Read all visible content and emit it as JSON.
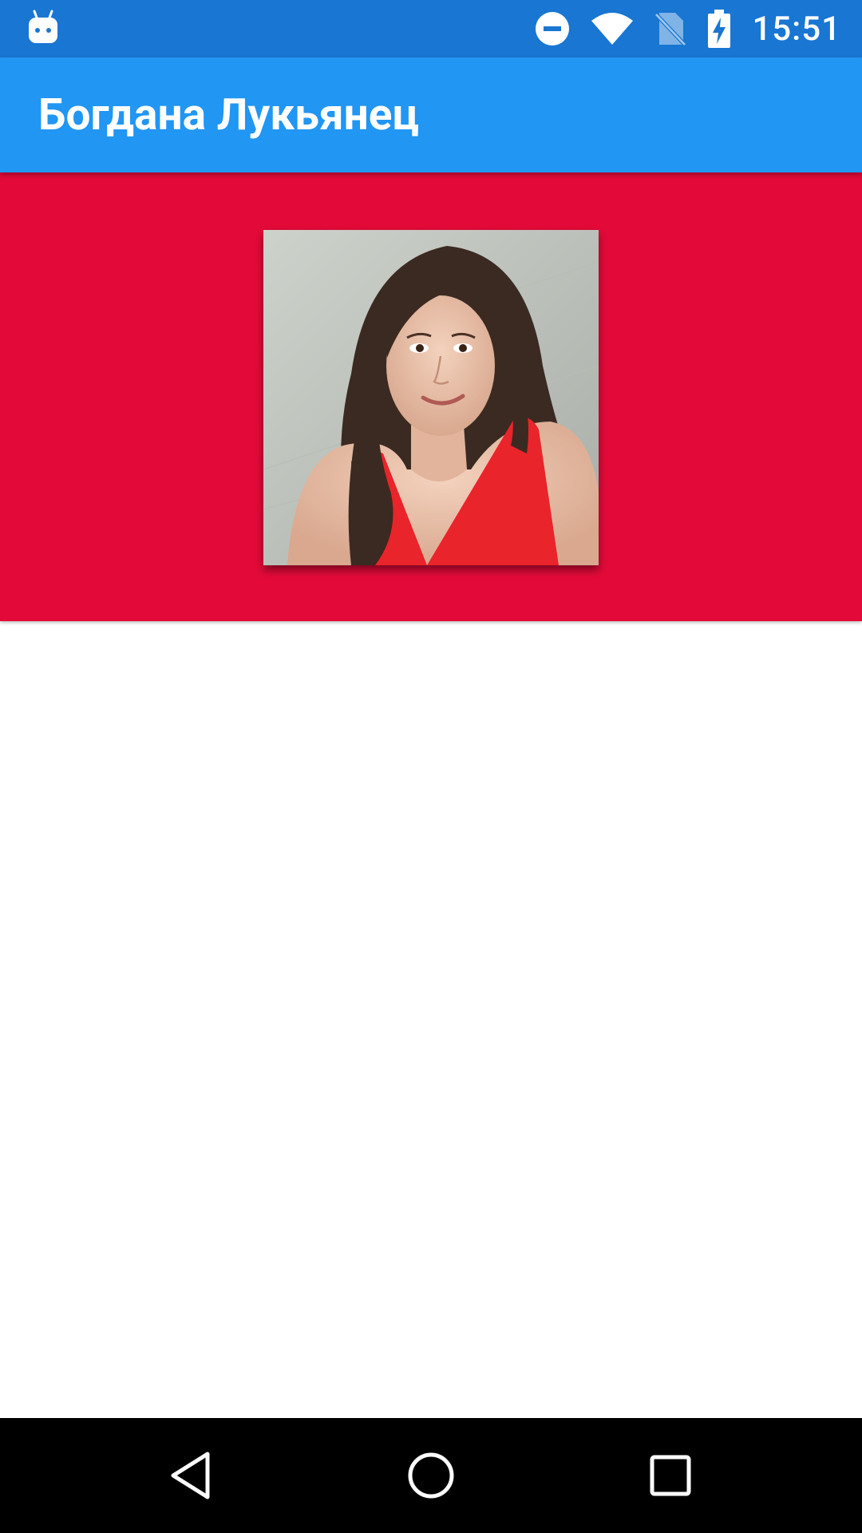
{
  "status_bar": {
    "time": "15:51",
    "icons": [
      "android-debug-icon",
      "do-not-disturb-icon",
      "wifi-icon",
      "no-sim-icon",
      "battery-charging-icon"
    ]
  },
  "app_bar": {
    "title": "Богдана Лукьянец"
  },
  "profile": {
    "photo_subject": "portrait of a woman with long dark hair in a red top"
  },
  "nav_bar": {
    "icons": [
      "back-icon",
      "home-icon",
      "recents-icon"
    ]
  },
  "colors": {
    "status_bar": "#1976d2",
    "app_bar": "#2196f3",
    "header_band": "#e30a39",
    "nav_bar": "#000000"
  }
}
